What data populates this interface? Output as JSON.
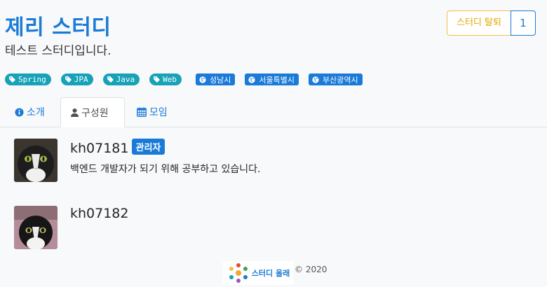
{
  "study": {
    "title": "제리 스터디",
    "description": "테스트 스터디입니다.",
    "leave_label": "스터디 탈퇴",
    "member_count": "1"
  },
  "tags": [
    "Spring",
    "JPA",
    "Java",
    "Web"
  ],
  "zones": [
    "성남시",
    "서울특별시",
    "부산광역시"
  ],
  "tabs": [
    {
      "label": "소개",
      "icon": "info-circle-icon"
    },
    {
      "label": "구성원",
      "icon": "user-icon",
      "active": true
    },
    {
      "label": "모임",
      "icon": "calendar-icon"
    }
  ],
  "members": [
    {
      "name": "kh07181",
      "badge": "관리자",
      "bio": "백엔드 개발자가 되기 위해 공부하고 있습니다."
    },
    {
      "name": "kh07182"
    }
  ],
  "footer": {
    "logo_text": "스터디 올래",
    "copyright": "© 2020"
  },
  "colors": {
    "primary": "#1a7ad8",
    "tag": "#17a2b8",
    "warning": "#e0a800"
  }
}
